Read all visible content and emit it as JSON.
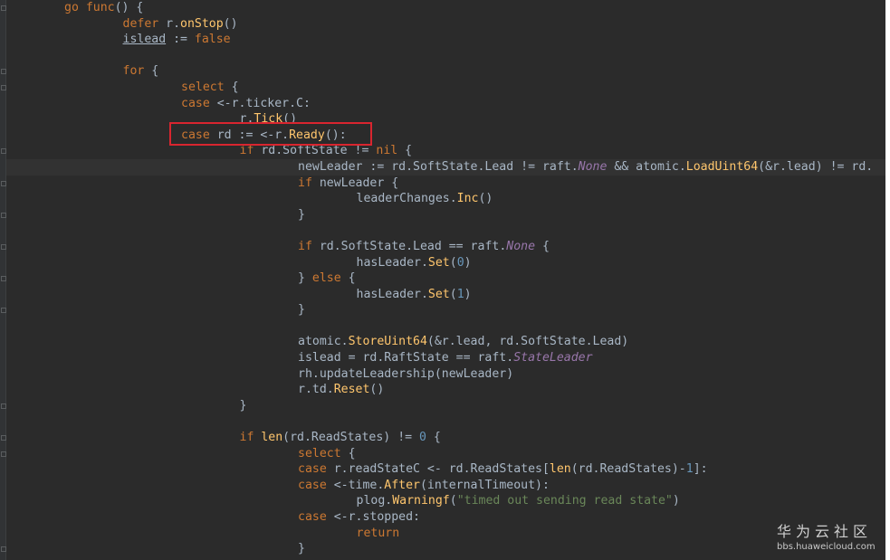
{
  "code_lines": [
    {
      "indent": 1,
      "tokens": [
        [
          "kw",
          "go "
        ],
        [
          "kw",
          "func"
        ],
        [
          "",
          "() {"
        ]
      ]
    },
    {
      "indent": 2,
      "tokens": [
        [
          "kw",
          "defer "
        ],
        [
          "",
          "r."
        ],
        [
          "fn",
          "onStop"
        ],
        [
          "",
          "()"
        ]
      ]
    },
    {
      "indent": 2,
      "tokens": [
        [
          "ul",
          "islead"
        ],
        [
          "",
          " := "
        ],
        [
          "kw",
          "false"
        ]
      ]
    },
    {
      "indent": 0,
      "tokens": []
    },
    {
      "indent": 2,
      "tokens": [
        [
          "kw",
          "for "
        ],
        [
          "",
          "{"
        ]
      ]
    },
    {
      "indent": 3,
      "tokens": [
        [
          "kw",
          "select "
        ],
        [
          "",
          "{"
        ]
      ]
    },
    {
      "indent": 3,
      "tokens": [
        [
          "kw",
          "case "
        ],
        [
          "",
          "<-r.ticker.C:"
        ]
      ]
    },
    {
      "indent": 4,
      "tokens": [
        [
          "",
          "r."
        ],
        [
          "fn",
          "Tick"
        ],
        [
          "",
          "()"
        ]
      ]
    },
    {
      "indent": 3,
      "tokens": [
        [
          "kw",
          "case "
        ],
        [
          "",
          "rd := <-r."
        ],
        [
          "fn",
          "Ready"
        ],
        [
          "",
          "():"
        ]
      ]
    },
    {
      "indent": 4,
      "tokens": [
        [
          "kw",
          "if "
        ],
        [
          "",
          "rd.SoftState != "
        ],
        [
          "kw",
          "nil "
        ],
        [
          "",
          "{"
        ]
      ]
    },
    {
      "indent": 5,
      "current": true,
      "tokens": [
        [
          "",
          "newLeader := rd.SoftState.Lead != raft."
        ],
        [
          "it",
          "None"
        ],
        [
          "",
          " && atomic."
        ],
        [
          "fn",
          "LoadUint64"
        ],
        [
          "",
          "(&r.lead) != rd."
        ]
      ]
    },
    {
      "indent": 5,
      "tokens": [
        [
          "kw",
          "if "
        ],
        [
          "",
          "newLeader {"
        ]
      ]
    },
    {
      "indent": 6,
      "tokens": [
        [
          "",
          "leaderChanges."
        ],
        [
          "fn",
          "Inc"
        ],
        [
          "",
          "()"
        ]
      ]
    },
    {
      "indent": 5,
      "tokens": [
        [
          "",
          "}"
        ]
      ]
    },
    {
      "indent": 0,
      "tokens": []
    },
    {
      "indent": 5,
      "tokens": [
        [
          "kw",
          "if "
        ],
        [
          "",
          "rd.SoftState.Lead == raft."
        ],
        [
          "it",
          "None"
        ],
        [
          "",
          " {"
        ]
      ]
    },
    {
      "indent": 6,
      "tokens": [
        [
          "",
          "hasLeader."
        ],
        [
          "fn",
          "Set"
        ],
        [
          "",
          "("
        ],
        [
          "num",
          "0"
        ],
        [
          "",
          ")"
        ]
      ]
    },
    {
      "indent": 5,
      "tokens": [
        [
          "",
          "} "
        ],
        [
          "kw",
          "else "
        ],
        [
          "",
          "{"
        ]
      ]
    },
    {
      "indent": 6,
      "tokens": [
        [
          "",
          "hasLeader."
        ],
        [
          "fn",
          "Set"
        ],
        [
          "",
          "("
        ],
        [
          "num",
          "1"
        ],
        [
          "",
          ")"
        ]
      ]
    },
    {
      "indent": 5,
      "tokens": [
        [
          "",
          "}"
        ]
      ]
    },
    {
      "indent": 0,
      "tokens": []
    },
    {
      "indent": 5,
      "tokens": [
        [
          "",
          "atomic."
        ],
        [
          "fn",
          "StoreUint64"
        ],
        [
          "",
          "(&r.lead, rd.SoftState.Lead)"
        ]
      ]
    },
    {
      "indent": 5,
      "tokens": [
        [
          "",
          "islead = rd.RaftState == raft."
        ],
        [
          "it",
          "StateLeader"
        ]
      ]
    },
    {
      "indent": 5,
      "tokens": [
        [
          "",
          "rh.updateLeadership(newLeader)"
        ]
      ]
    },
    {
      "indent": 5,
      "tokens": [
        [
          "",
          "r.td."
        ],
        [
          "fn",
          "Reset"
        ],
        [
          "",
          "()"
        ]
      ]
    },
    {
      "indent": 4,
      "tokens": [
        [
          "",
          "}"
        ]
      ]
    },
    {
      "indent": 0,
      "tokens": []
    },
    {
      "indent": 4,
      "tokens": [
        [
          "kw",
          "if "
        ],
        [
          "fn",
          "len"
        ],
        [
          "",
          "(rd.ReadStates) != "
        ],
        [
          "num",
          "0"
        ],
        [
          "",
          " {"
        ]
      ]
    },
    {
      "indent": 5,
      "tokens": [
        [
          "kw",
          "select "
        ],
        [
          "",
          "{"
        ]
      ]
    },
    {
      "indent": 5,
      "tokens": [
        [
          "kw",
          "case "
        ],
        [
          "",
          "r.readStateC <- rd.ReadStates["
        ],
        [
          "fn",
          "len"
        ],
        [
          "",
          "(rd.ReadStates)-"
        ],
        [
          "num",
          "1"
        ],
        [
          "",
          "]:"
        ]
      ]
    },
    {
      "indent": 5,
      "tokens": [
        [
          "kw",
          "case "
        ],
        [
          "",
          "<-time."
        ],
        [
          "fn",
          "After"
        ],
        [
          "",
          "(internalTimeout):"
        ]
      ]
    },
    {
      "indent": 6,
      "tokens": [
        [
          "",
          "plog."
        ],
        [
          "fn",
          "Warningf"
        ],
        [
          "",
          "("
        ],
        [
          "str",
          "\"timed out sending read state\""
        ],
        [
          "",
          ")"
        ]
      ]
    },
    {
      "indent": 5,
      "tokens": [
        [
          "kw",
          "case "
        ],
        [
          "",
          "<-r.stopped:"
        ]
      ]
    },
    {
      "indent": 6,
      "tokens": [
        [
          "kw",
          "return"
        ]
      ]
    },
    {
      "indent": 5,
      "tokens": [
        [
          "",
          "}"
        ]
      ]
    }
  ],
  "watermark": {
    "title": "华为云社区",
    "url": "bbs.huaweicloud.com"
  }
}
